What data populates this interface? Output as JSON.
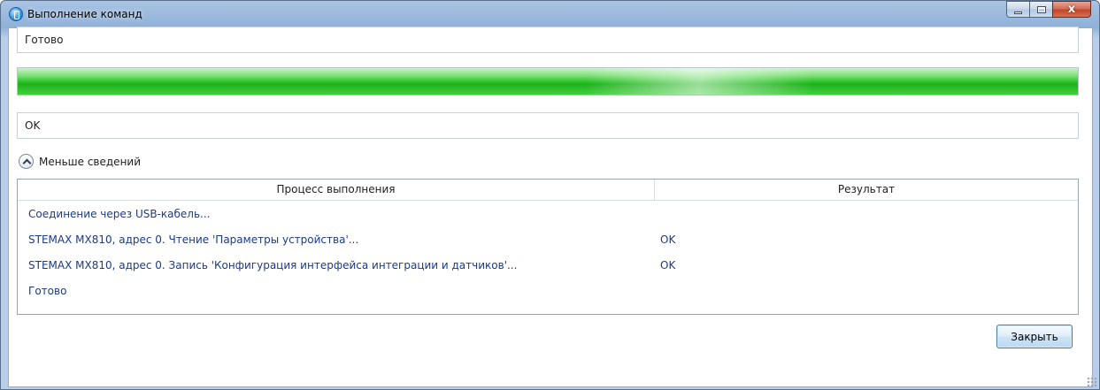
{
  "window": {
    "title": "Выполнение команд",
    "close_glyph": "x"
  },
  "status_text": "Готово",
  "progress": {
    "percent": 100
  },
  "result_text": "OK",
  "details_toggle": {
    "label": "Меньше сведений"
  },
  "log": {
    "columns": [
      "Процесс выполнения",
      "Результат"
    ],
    "rows": [
      {
        "process": "Соединение через USB-кабель...",
        "result": ""
      },
      {
        "process": "STEMAX MX810, адрес 0. Чтение 'Параметры устройства'...",
        "result": "OK"
      },
      {
        "process": "STEMAX MX810, адрес 0. Запись 'Конфигурация интерфейса интеграции и датчиков'...",
        "result": "OK"
      },
      {
        "process": "Готово",
        "result": ""
      }
    ]
  },
  "buttons": {
    "close_label": "Закрыть"
  },
  "colors": {
    "progress_green": "#1fb01d",
    "log_text_blue": "#1a3a8a",
    "titlebar_blue": "#8fb0d8"
  }
}
